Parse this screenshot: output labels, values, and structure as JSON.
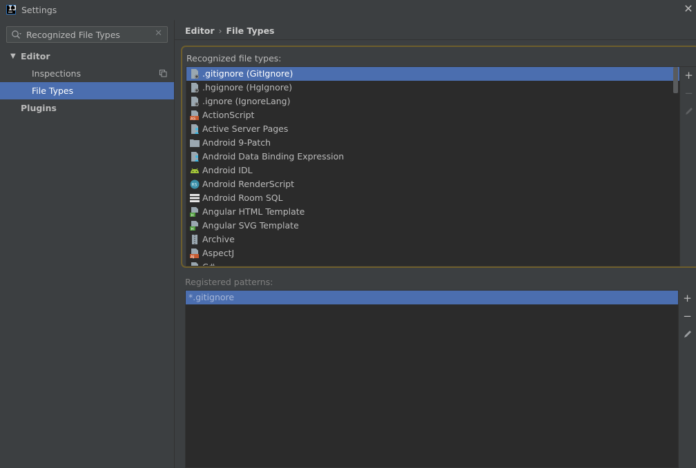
{
  "window": {
    "title": "Settings"
  },
  "search": {
    "value": "Recognized File Types",
    "placeholder": ""
  },
  "tree": {
    "editor_label": "Editor",
    "inspections_label": "Inspections",
    "file_types_label": "File Types",
    "plugins_label": "Plugins"
  },
  "breadcrumb": {
    "parent": "Editor",
    "separator": "›",
    "current": "File Types"
  },
  "recognized": {
    "label": "Recognized file types:",
    "items": [
      {
        "label": ".gitignore (GitIgnore)",
        "icon": "gitignore-file-icon",
        "selected": true
      },
      {
        "label": ".hgignore (HgIgnore)",
        "icon": "hgignore-file-icon"
      },
      {
        "label": ".ignore (IgnoreLang)",
        "icon": "ignore-file-icon"
      },
      {
        "label": "ActionScript",
        "icon": "actionscript-file-icon"
      },
      {
        "label": "Active Server Pages",
        "icon": "asp-file-icon"
      },
      {
        "label": "Android 9-Patch",
        "icon": "folder-icon"
      },
      {
        "label": "Android Data Binding Expression",
        "icon": "data-binding-file-icon"
      },
      {
        "label": "Android IDL",
        "icon": "android-icon"
      },
      {
        "label": "Android RenderScript",
        "icon": "renderscript-icon"
      },
      {
        "label": "Android Room SQL",
        "icon": "sql-table-icon"
      },
      {
        "label": "Angular HTML Template",
        "icon": "angular-html-icon"
      },
      {
        "label": "Angular SVG Template",
        "icon": "angular-svg-icon"
      },
      {
        "label": "Archive",
        "icon": "archive-icon"
      },
      {
        "label": "AspectJ",
        "icon": "aspectj-file-icon"
      },
      {
        "label": "C#",
        "icon": "csharp-file-icon"
      }
    ]
  },
  "registered": {
    "label": "Registered patterns:",
    "items": [
      {
        "label": "*.gitignore",
        "selected": true
      }
    ]
  },
  "toolbar": {
    "add": "+",
    "remove": "−"
  },
  "colors": {
    "selection": "#4b6eaf",
    "background": "#3c3f41",
    "list_bg": "#2b2b2b",
    "focus_border": "#6e5e2c"
  }
}
